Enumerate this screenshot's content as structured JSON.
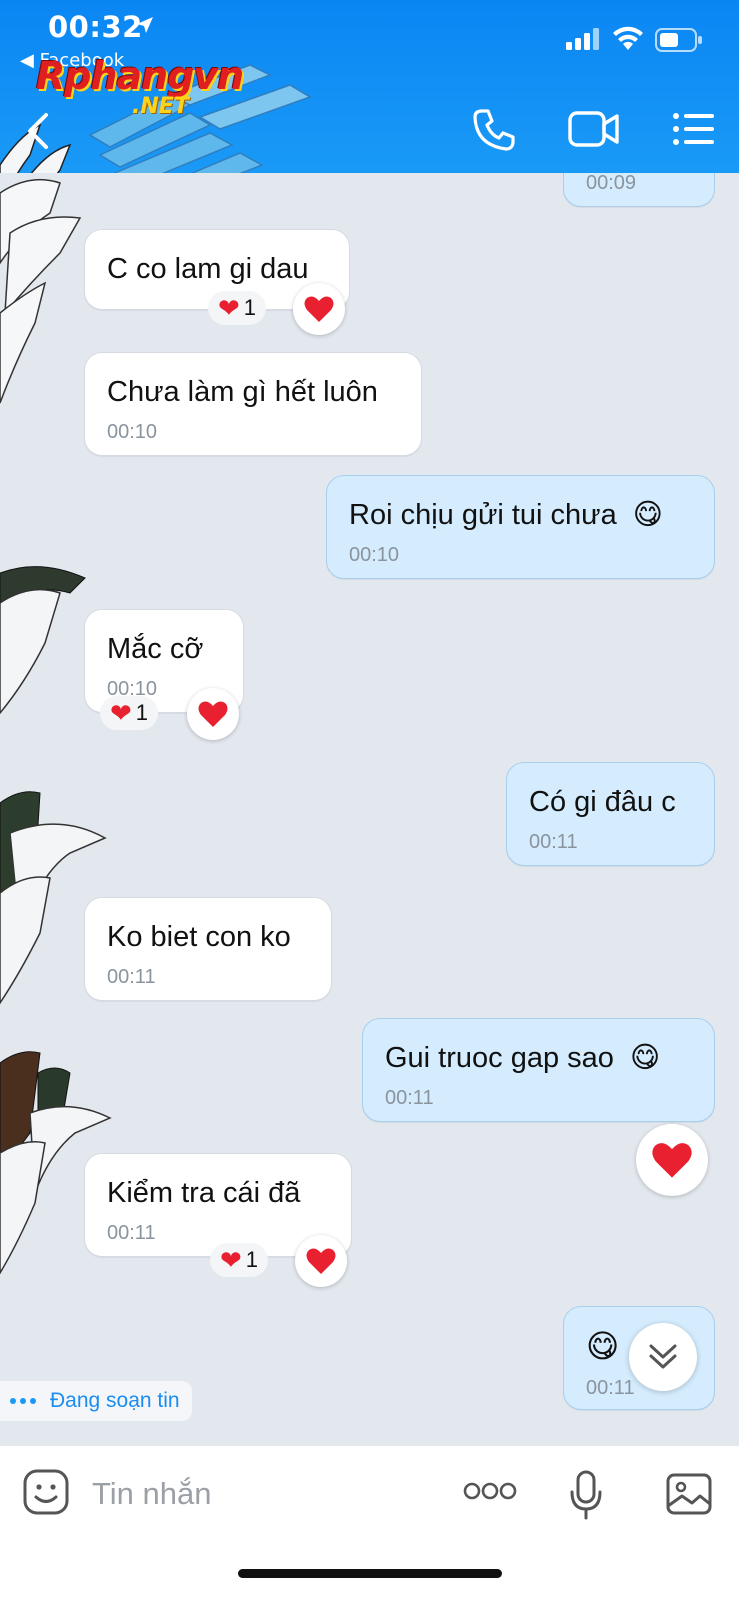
{
  "status_bar": {
    "time": "00:32",
    "back_app": "◀ Facebook"
  },
  "watermark": {
    "main": "Rphangvn",
    "sub": ".NET"
  },
  "header": {
    "call_icon": "phone-icon",
    "video_icon": "video-camera-icon",
    "menu_icon": "list-menu-icon",
    "accent": "#0a86f3"
  },
  "messages": [
    {
      "dir": "out",
      "text": "",
      "time": "00:09"
    },
    {
      "dir": "in",
      "text": "C co lam gi dau",
      "time": "",
      "reaction": "❤",
      "reaction_count": "1"
    },
    {
      "dir": "in",
      "text": "Chưa làm gì hết luôn",
      "time": "00:10"
    },
    {
      "dir": "out",
      "text": "Roi chịu gửi tui chưa",
      "emoji": "😋",
      "time": "00:10"
    },
    {
      "dir": "in",
      "text": "Mắc cỡ",
      "time": "00:10",
      "reaction": "❤",
      "reaction_count": "1"
    },
    {
      "dir": "out",
      "text": "Có gi đâu c",
      "time": "00:11"
    },
    {
      "dir": "in",
      "text": "Ko biet con ko",
      "time": "00:11"
    },
    {
      "dir": "out",
      "text": "Gui truoc gap sao",
      "emoji": "😋",
      "time": "00:11"
    },
    {
      "dir": "in",
      "text": "Kiểm tra cái đã",
      "time": "00:11",
      "reaction": "❤",
      "reaction_count": "1"
    },
    {
      "dir": "out",
      "text": "",
      "emoji": "😋",
      "time": "00:11"
    }
  ],
  "typing_indicator": "Đang soạn tin",
  "input": {
    "placeholder": "Tin nhắn"
  },
  "colors": {
    "heart": "#e8202f",
    "incoming_bubble": "#ffffff",
    "outgoing_bubble": "#d4ecfd",
    "chat_bg": "#e3e8ef"
  }
}
